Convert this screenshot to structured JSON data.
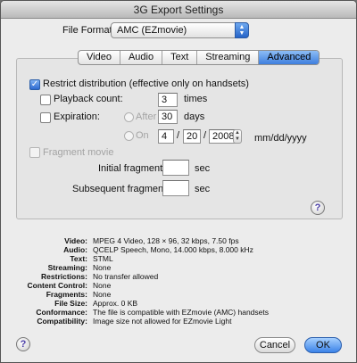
{
  "window": {
    "title": "3G Export Settings"
  },
  "format": {
    "label": "File Format:",
    "value": "AMC (EZmovie)"
  },
  "tabs": [
    {
      "label": "Video"
    },
    {
      "label": "Audio"
    },
    {
      "label": "Text"
    },
    {
      "label": "Streaming"
    },
    {
      "label": "Advanced"
    }
  ],
  "advanced": {
    "restrict_label": "Restrict distribution (effective only on handsets)",
    "playback_label": "Playback count:",
    "playback_value": "3",
    "playback_unit": "times",
    "expiration_label": "Expiration:",
    "after_label": "After",
    "after_value": "30",
    "after_unit": "days",
    "on_label": "On",
    "date_month": "4",
    "date_sep1": "/",
    "date_day": "20",
    "date_sep2": "/",
    "date_year": "2008",
    "date_format": "mm/dd/yyyy",
    "fragment_label": "Fragment movie",
    "initial_label": "Initial fragment:",
    "initial_value": "",
    "initial_unit": "sec",
    "subsequent_label": "Subsequent fragments:",
    "subsequent_value": "",
    "subsequent_unit": "sec"
  },
  "summary": [
    {
      "key": "Video:",
      "value": "MPEG 4 Video, 128 × 96, 32 kbps, 7.50 fps"
    },
    {
      "key": "Audio:",
      "value": "QCELP Speech, Mono, 14.000 kbps, 8.000 kHz"
    },
    {
      "key": "Text:",
      "value": "STML"
    },
    {
      "key": "Streaming:",
      "value": "None"
    },
    {
      "key": "Restrictions:",
      "value": "No transfer allowed"
    },
    {
      "key": "Content Control:",
      "value": "None"
    },
    {
      "key": "Fragments:",
      "value": "None"
    },
    {
      "key": "File Size:",
      "value": "Approx. 0 KB"
    },
    {
      "key": "Conformance:",
      "value": "The file is compatible with EZmovie (AMC) handsets"
    },
    {
      "key": "Compatibility:",
      "value": "Image size not allowed for EZmovie Light"
    }
  ],
  "buttons": {
    "cancel": "Cancel",
    "ok": "OK"
  },
  "icons": {
    "help": "?",
    "checkmark": "✓"
  }
}
